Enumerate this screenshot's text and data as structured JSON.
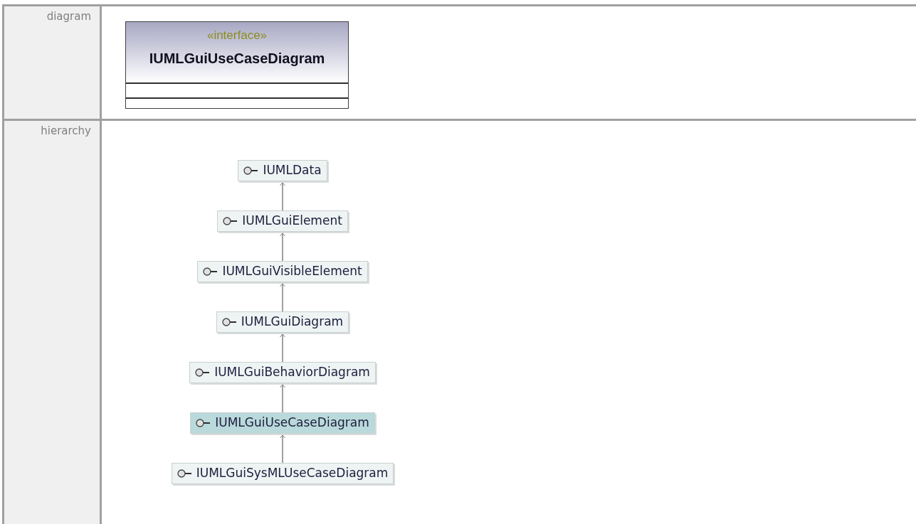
{
  "rows": [
    {
      "label": "diagram",
      "kind": "class_box",
      "stereotype": "«interface»",
      "name": "IUMLGuiUseCaseDiagram"
    },
    {
      "label": "hierarchy",
      "kind": "hierarchy",
      "nodes": [
        {
          "name": "IUMLData",
          "selected": false
        },
        {
          "name": "IUMLGuiElement",
          "selected": false
        },
        {
          "name": "IUMLGuiVisibleElement",
          "selected": false
        },
        {
          "name": "IUMLGuiDiagram",
          "selected": false
        },
        {
          "name": "IUMLGuiBehaviorDiagram",
          "selected": false
        },
        {
          "name": "IUMLGuiUseCaseDiagram",
          "selected": true
        },
        {
          "name": "IUMLGuiSysMLUseCaseDiagram",
          "selected": false
        }
      ]
    }
  ]
}
